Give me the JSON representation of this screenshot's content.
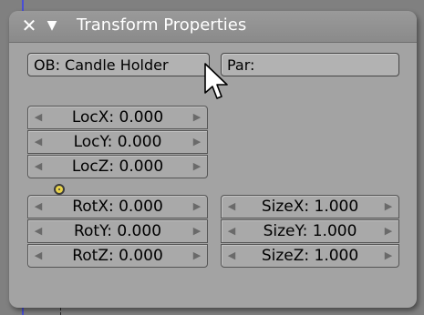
{
  "panel": {
    "title": "Transform Properties",
    "close_icon": "close-icon",
    "collapse_icon": "triangle-down-icon"
  },
  "object": {
    "name_field": "OB: Candle Holder",
    "parent_field": "Par:"
  },
  "location": {
    "x": "LocX: 0.000",
    "y": "LocY: 0.000",
    "z": "LocZ: 0.000"
  },
  "rotation": {
    "x": "RotX: 0.000",
    "y": "RotY: 0.000",
    "z": "RotZ: 0.000"
  },
  "size": {
    "x": "SizeX: 1.000",
    "y": "SizeY: 1.000",
    "z": "SizeZ: 1.000"
  },
  "colors": {
    "panel_bg": "#a3a3a3",
    "header_bg": "#8e8e8e",
    "axis_blue": "#4a4fd6",
    "viewport_bg": "#808080"
  }
}
